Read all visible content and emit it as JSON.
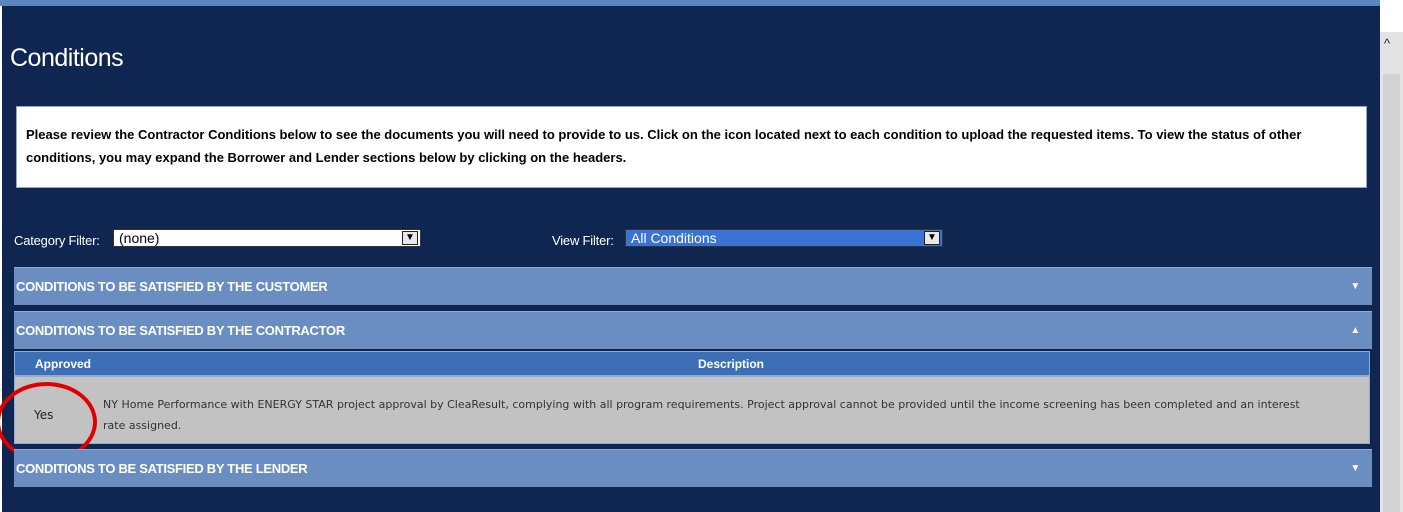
{
  "page": {
    "title": "Conditions",
    "instructions": "Please review the Contractor Conditions below to see the documents you will need to provide to us. Click on the icon located next to each condition to upload the requested items. To view the status of other conditions, you may expand the Borrower and Lender sections below by clicking on the headers."
  },
  "filters": {
    "category_label": "Category Filter:",
    "category_value": "(none)",
    "view_label": "View Filter:",
    "view_value": "All Conditions"
  },
  "sections": [
    {
      "label": "CONDITIONS TO BE SATISFIED BY THE CUSTOMER",
      "expanded": false
    },
    {
      "label": "CONDITIONS TO BE SATISFIED BY THE CONTRACTOR",
      "expanded": true
    },
    {
      "label": "CONDITIONS TO BE SATISFIED BY THE LENDER",
      "expanded": false
    }
  ],
  "table": {
    "headers": {
      "approved": "Approved",
      "description": "Description"
    },
    "rows": [
      {
        "approved": "Yes",
        "description": "NY Home Performance with ENERGY STAR project approval by CleaResult, complying with all program requirements. Project approval cannot be provided until the income screening has been completed and an interest rate assigned."
      }
    ]
  },
  "icons": {
    "collapsed": "chevron-down-icon",
    "expanded": "chevron-up-icon",
    "dropdown": "dropdown-arrow-icon"
  },
  "colors": {
    "panel_bg": "#0f2750",
    "section_header": "#6a8ec2",
    "table_header": "#3d6fb6",
    "row_bg": "#c2c2c2",
    "highlight_circle": "#e00000",
    "view_select_bg": "#3b73d4"
  }
}
